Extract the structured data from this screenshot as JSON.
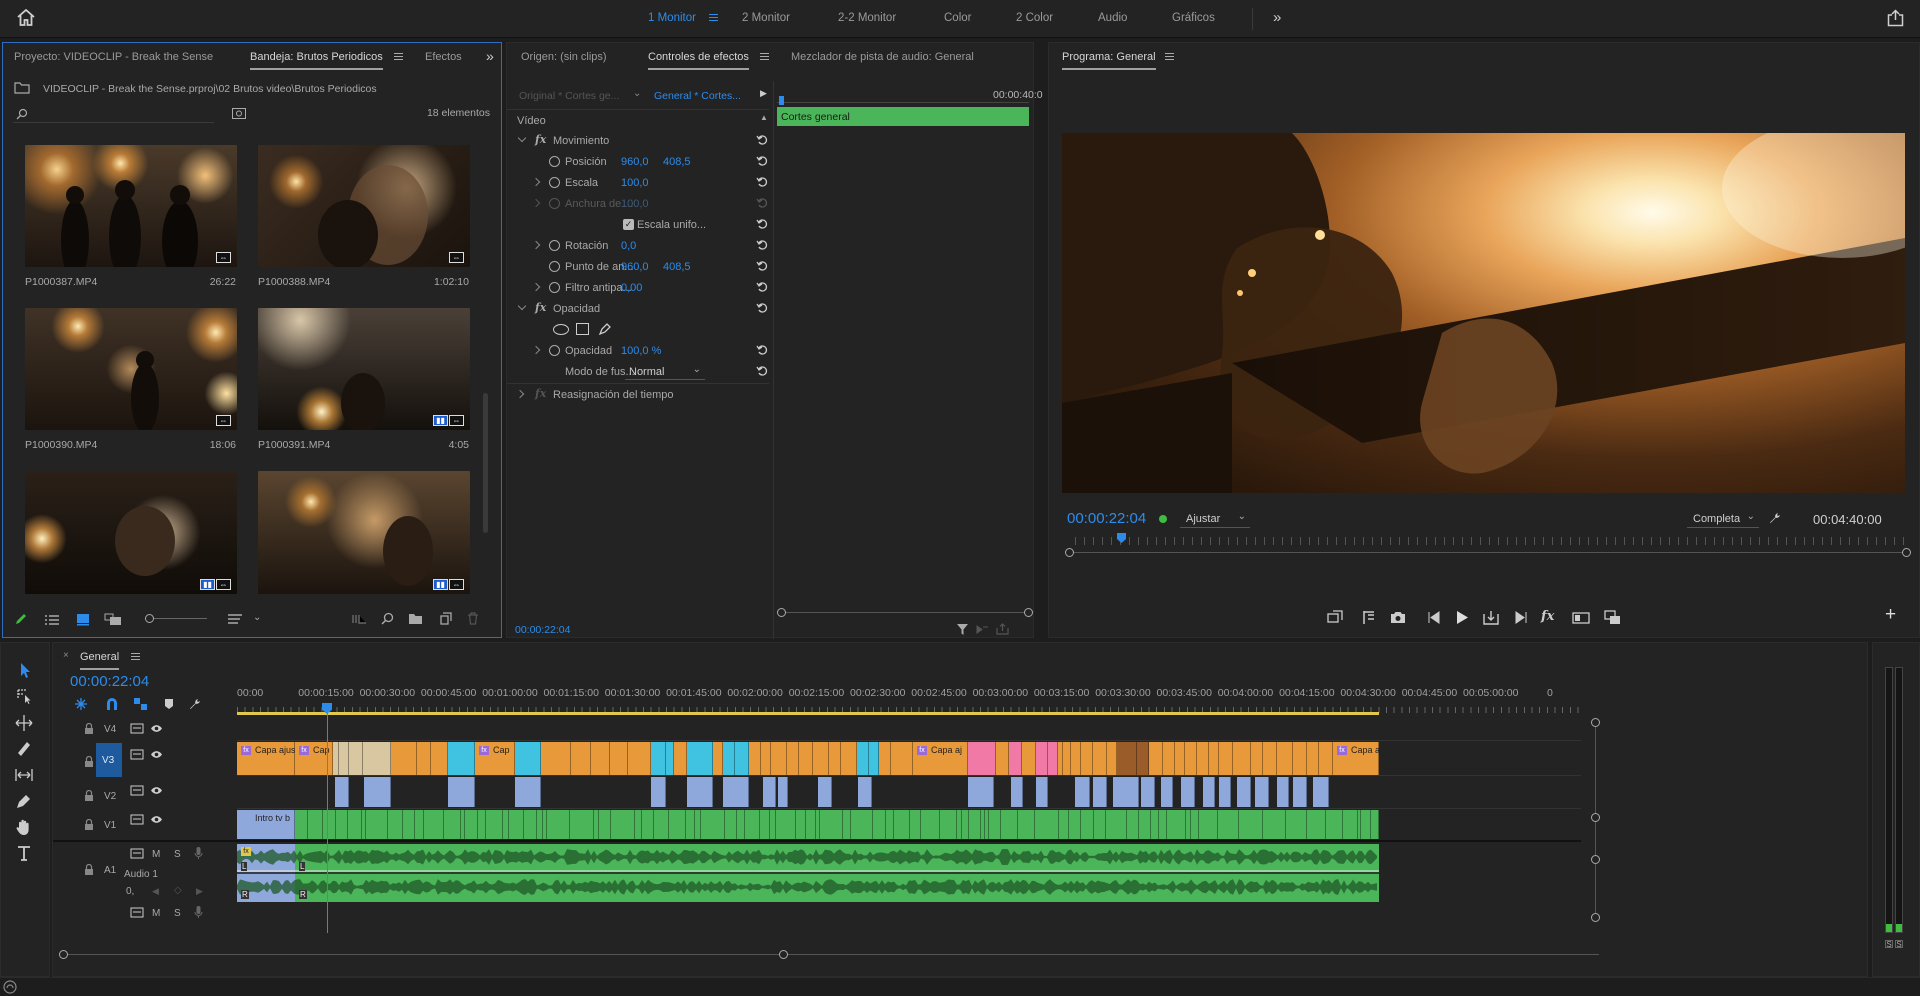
{
  "workspaces": {
    "items": [
      "1 Monitor",
      "2 Monitor",
      "2-2 Monitor",
      "Color",
      "2 Color",
      "Audio",
      "Gráficos"
    ],
    "active_index": 0,
    "more": "»"
  },
  "project_panel": {
    "tabs": [
      "Proyecto: VIDEOCLIP - Break the Sense",
      "Bandeja: Brutos Periodicos",
      "Efectos"
    ],
    "active_tab": "Bandeja: Brutos Periodicos",
    "path": "VIDEOCLIP - Break the Sense.prproj\\02 Brutos video\\Brutos Periodicos",
    "search_placeholder": "",
    "item_count": "18 elementos",
    "items": [
      {
        "name": "P1000387.MP4",
        "duration": "26:22"
      },
      {
        "name": "P1000388.MP4",
        "duration": "1:02:10"
      },
      {
        "name": "P1000390.MP4",
        "duration": "18:06"
      },
      {
        "name": "P1000391.MP4",
        "duration": "4:05"
      },
      {
        "name": "",
        "duration": ""
      },
      {
        "name": "",
        "duration": ""
      }
    ]
  },
  "effect_panel": {
    "tabs": [
      "Origen: (sin clips)",
      "Controles de efectos",
      "Mezclador de pista de audio: General"
    ],
    "active_tab": "Controles de efectos",
    "source_label": "Original * Cortes ge...",
    "sequence_label": "General * Cortes...",
    "mini_timecode": "00:00:40:0",
    "clip_bar_label": "Cortes general",
    "section_video": "Vídeo",
    "motion": "Movimiento",
    "position_label": "Posición",
    "position_x": "960,0",
    "position_y": "408,5",
    "scale_label": "Escala",
    "scale_value": "100,0",
    "width_label": "Anchura de ...",
    "width_value": "100,0",
    "uniform_label": "Escala unifo...",
    "rotation_label": "Rotación",
    "rotation_value": "0,0",
    "anchor_label": "Punto de an...",
    "anchor_x": "960,0",
    "anchor_y": "408,5",
    "antiflicker_label": "Filtro antipa...",
    "antiflicker_value": "0,00",
    "opacity_section": "Opacidad",
    "opacity_label": "Opacidad",
    "opacity_value": "100,0 %",
    "blend_label": "Modo de fus...",
    "blend_value": "Normal",
    "time_remap": "Reasignación del tiempo",
    "bottom_timecode": "00:00:22:04"
  },
  "program_monitor": {
    "title": "Programa: General",
    "timecode": "00:00:22:04",
    "fit": "Ajustar",
    "quality": "Completa",
    "duration": "00:04:40:00"
  },
  "timeline": {
    "sequence": "General",
    "timecode": "00:00:22:04",
    "ruler": [
      "00:00",
      "00:00:15:00",
      "00:00:30:00",
      "00:00:45:00",
      "00:01:00:00",
      "00:01:15:00",
      "00:01:30:00",
      "00:01:45:00",
      "00:02:00:00",
      "00:02:15:00",
      "00:02:30:00",
      "00:02:45:00",
      "00:03:00:00",
      "00:03:15:00",
      "00:03:30:00",
      "00:03:45:00",
      "00:04:00:00",
      "00:04:15:00",
      "00:04:30:00",
      "00:04:45:00",
      "00:05:00:00",
      "0"
    ],
    "tracks": {
      "v4": "V4",
      "v3": "V3",
      "v2": "V2",
      "v1": "V1",
      "a1": "A1",
      "a1_name": "Audio 1",
      "audio_level": "0,"
    },
    "clips": {
      "v3_first": "Capa ajus",
      "v3_cap1": "Cap",
      "v3_cap2": "Cap",
      "v3_capaj": "Capa aj",
      "v3_last": "Capa a",
      "v1_first": "Intro tv b",
      "a1_left": "L",
      "a1_right": "R"
    },
    "meter_labels": [
      "S",
      "S"
    ]
  },
  "colors": {
    "accent": "#2d8ceb",
    "clip_orange": "#e8993a",
    "clip_cyan": "#3fc3e0",
    "clip_pink": "#f07aa5",
    "clip_beige": "#d8c7a0",
    "clip_blue": "#8fa8dc",
    "clip_green": "#4bb55a",
    "clip_brown": "#9a5d2a"
  }
}
